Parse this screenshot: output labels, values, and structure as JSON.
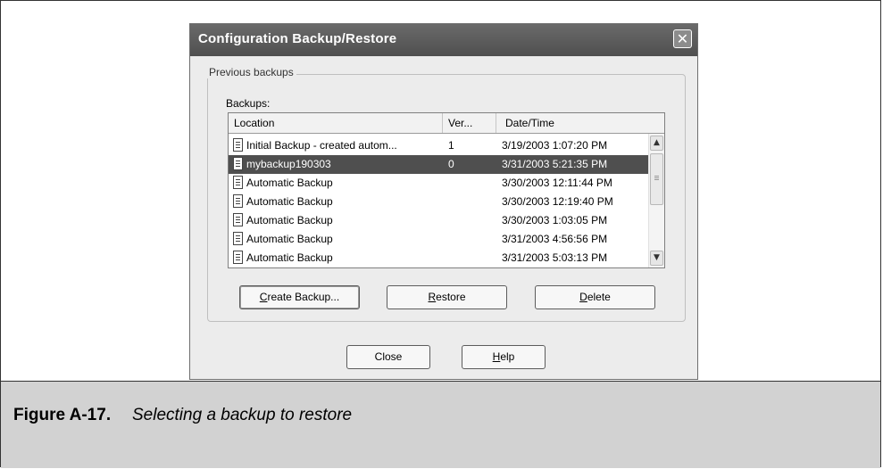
{
  "dialog": {
    "title": "Configuration Backup/Restore",
    "close_glyph": "✕",
    "group_label": "Previous backups",
    "backups_label": "Backups:"
  },
  "listview": {
    "columns": [
      "Location",
      "Ver...",
      "Date/Time"
    ],
    "rows": [
      {
        "location": "Initial Backup - created autom...",
        "version": "1",
        "datetime": "3/19/2003 1:07:20 PM",
        "selected": false
      },
      {
        "location": "mybackup190303",
        "version": "0",
        "datetime": "3/31/2003 5:21:35 PM",
        "selected": true
      },
      {
        "location": "Automatic Backup",
        "version": "",
        "datetime": "3/30/2003 12:11:44 PM",
        "selected": false
      },
      {
        "location": "Automatic Backup",
        "version": "",
        "datetime": "3/30/2003 12:19:40 PM",
        "selected": false
      },
      {
        "location": "Automatic Backup",
        "version": "",
        "datetime": "3/30/2003 1:03:05 PM",
        "selected": false
      },
      {
        "location": "Automatic Backup",
        "version": "",
        "datetime": "3/31/2003 4:56:56 PM",
        "selected": false
      },
      {
        "location": "Automatic Backup",
        "version": "",
        "datetime": "3/31/2003 5:03:13 PM",
        "selected": false
      }
    ]
  },
  "buttons": {
    "create_backup": {
      "pre": "",
      "key": "C",
      "post": "reate Backup..."
    },
    "restore": {
      "pre": "",
      "key": "R",
      "post": "estore"
    },
    "delete": {
      "pre": "",
      "key": "D",
      "post": "elete"
    },
    "close": {
      "pre": "Close",
      "key": "",
      "post": ""
    },
    "help": {
      "pre": "",
      "key": "H",
      "post": "elp"
    }
  },
  "icons": {
    "document": "document-icon",
    "close": "close-icon",
    "scroll_up": "chevron-up-icon",
    "scroll_down": "chevron-down-icon"
  },
  "caption": {
    "label": "Figure A-17.",
    "text": "Selecting a backup to restore"
  },
  "colors": {
    "titlebar": "#5a5a5a",
    "selection": "#4f4f4f",
    "caption_bg": "#d2d2d2"
  }
}
